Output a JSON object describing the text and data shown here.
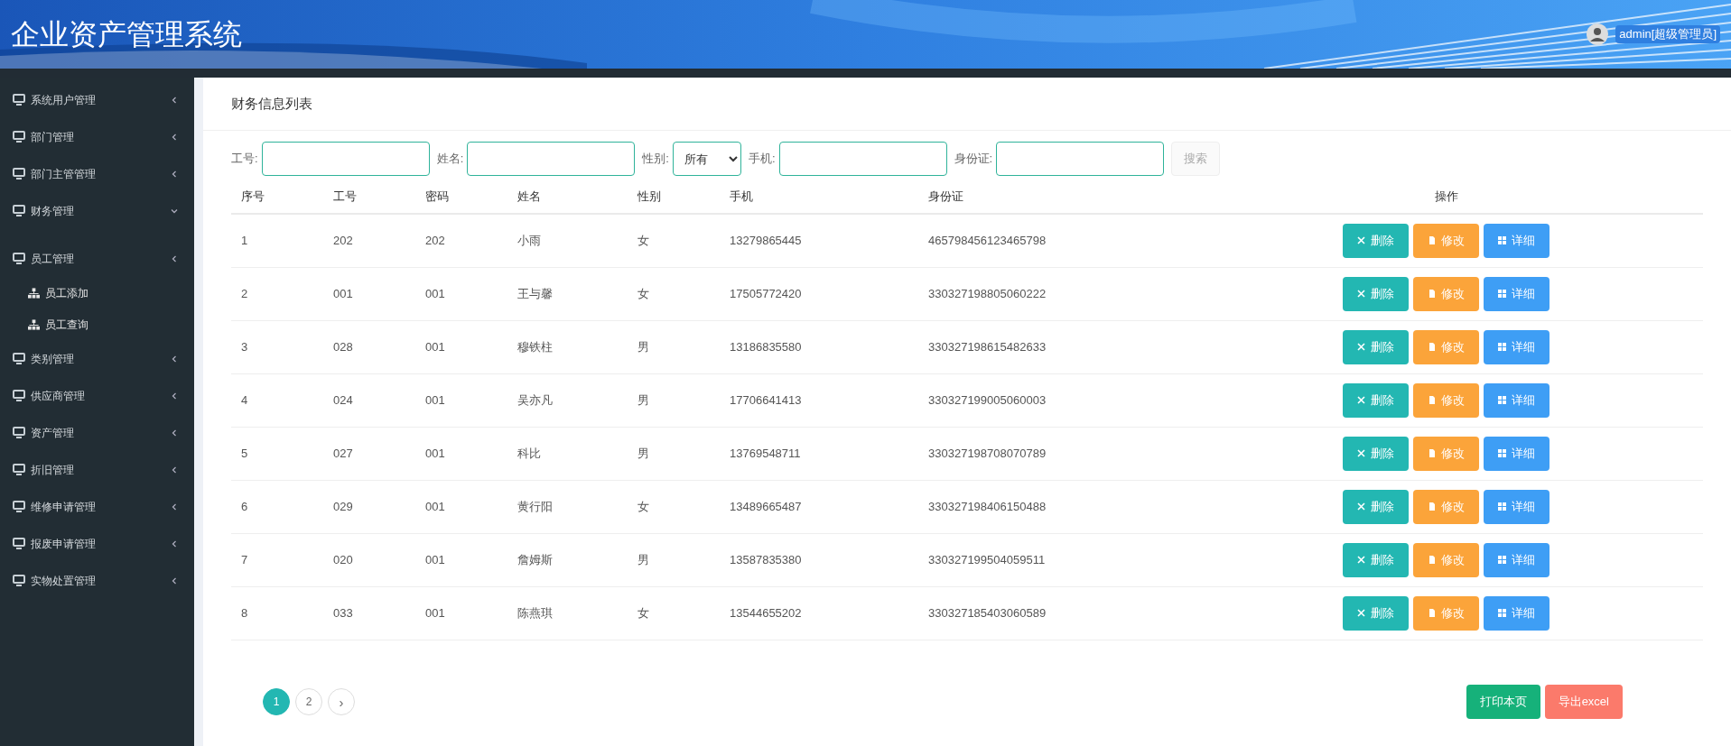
{
  "header": {
    "title": "企业资产管理系统",
    "user": "admin[超级管理员]"
  },
  "sidebar": {
    "items": [
      {
        "label": "系统用户管理",
        "expanded": false
      },
      {
        "label": "部门管理",
        "expanded": false
      },
      {
        "label": "部门主管管理",
        "expanded": false
      },
      {
        "label": "财务管理",
        "expanded": true
      },
      {
        "label": "员工管理",
        "expanded": false,
        "children": [
          {
            "label": "员工添加"
          },
          {
            "label": "员工查询"
          }
        ]
      },
      {
        "label": "类别管理",
        "expanded": false
      },
      {
        "label": "供应商管理",
        "expanded": false
      },
      {
        "label": "资产管理",
        "expanded": false
      },
      {
        "label": "折旧管理",
        "expanded": false
      },
      {
        "label": "维修申请管理",
        "expanded": false
      },
      {
        "label": "报废申请管理",
        "expanded": false
      },
      {
        "label": "实物处置管理",
        "expanded": false
      }
    ]
  },
  "panel": {
    "title": "财务信息列表"
  },
  "search": {
    "fields": [
      {
        "label": "工号:",
        "kind": "text"
      },
      {
        "label": "姓名:",
        "kind": "text"
      },
      {
        "label": "性别:",
        "kind": "select",
        "value": "所有"
      },
      {
        "label": "手机:",
        "kind": "text"
      },
      {
        "label": "身份证:",
        "kind": "text"
      }
    ],
    "button": "搜索"
  },
  "table": {
    "columns": [
      "序号",
      "工号",
      "密码",
      "姓名",
      "性别",
      "手机",
      "身份证",
      "操作"
    ],
    "rows": [
      {
        "cells": [
          "1",
          "202",
          "202",
          "小雨",
          "女",
          "13279865445",
          "465798456123465798"
        ],
        "actions": [
          {
            "label": "删除",
            "kind": "delete"
          },
          {
            "label": "修改",
            "kind": "edit"
          },
          {
            "label": "详细",
            "kind": "detail"
          }
        ]
      },
      {
        "cells": [
          "2",
          "001",
          "001",
          "王与馨",
          "女",
          "17505772420",
          "330327198805060222"
        ],
        "actions": [
          {
            "label": "删除",
            "kind": "delete"
          },
          {
            "label": "修改",
            "kind": "edit"
          },
          {
            "label": "详细",
            "kind": "detail"
          }
        ]
      },
      {
        "cells": [
          "3",
          "028",
          "001",
          "穆铁柱",
          "男",
          "13186835580",
          "330327198615482633"
        ],
        "actions": [
          {
            "label": "删除",
            "kind": "delete"
          },
          {
            "label": "修改",
            "kind": "edit"
          },
          {
            "label": "详细",
            "kind": "detail"
          }
        ]
      },
      {
        "cells": [
          "4",
          "024",
          "001",
          "吴亦凡",
          "男",
          "17706641413",
          "330327199005060003"
        ],
        "actions": [
          {
            "label": "删除",
            "kind": "delete"
          },
          {
            "label": "修改",
            "kind": "edit"
          },
          {
            "label": "详细",
            "kind": "detail"
          }
        ]
      },
      {
        "cells": [
          "5",
          "027",
          "001",
          "科比",
          "男",
          "13769548711",
          "330327198708070789"
        ],
        "actions": [
          {
            "label": "删除",
            "kind": "delete"
          },
          {
            "label": "修改",
            "kind": "edit"
          },
          {
            "label": "详细",
            "kind": "detail"
          }
        ]
      },
      {
        "cells": [
          "6",
          "029",
          "001",
          "黄行阳",
          "女",
          "13489665487",
          "330327198406150488"
        ],
        "actions": [
          {
            "label": "删除",
            "kind": "delete"
          },
          {
            "label": "修改",
            "kind": "edit"
          },
          {
            "label": "详细",
            "kind": "detail"
          }
        ]
      },
      {
        "cells": [
          "7",
          "020",
          "001",
          "詹姆斯",
          "男",
          "13587835380",
          "330327199504059511"
        ],
        "actions": [
          {
            "label": "删除",
            "kind": "delete"
          },
          {
            "label": "修改",
            "kind": "edit"
          },
          {
            "label": "详细",
            "kind": "detail"
          }
        ]
      },
      {
        "cells": [
          "8",
          "033",
          "001",
          "陈燕琪",
          "女",
          "13544655202",
          "330327185403060589"
        ],
        "actions": [
          {
            "label": "删除",
            "kind": "delete"
          },
          {
            "label": "修改",
            "kind": "edit"
          },
          {
            "label": "详细",
            "kind": "detail"
          }
        ]
      }
    ]
  },
  "pagination": {
    "pages": [
      {
        "label": "1",
        "selected": true
      },
      {
        "label": "2",
        "selected": false
      }
    ],
    "next": "›"
  },
  "footer_buttons": [
    {
      "label": "打印本页",
      "kind": "print"
    },
    {
      "label": "导出excel",
      "kind": "export"
    }
  ]
}
